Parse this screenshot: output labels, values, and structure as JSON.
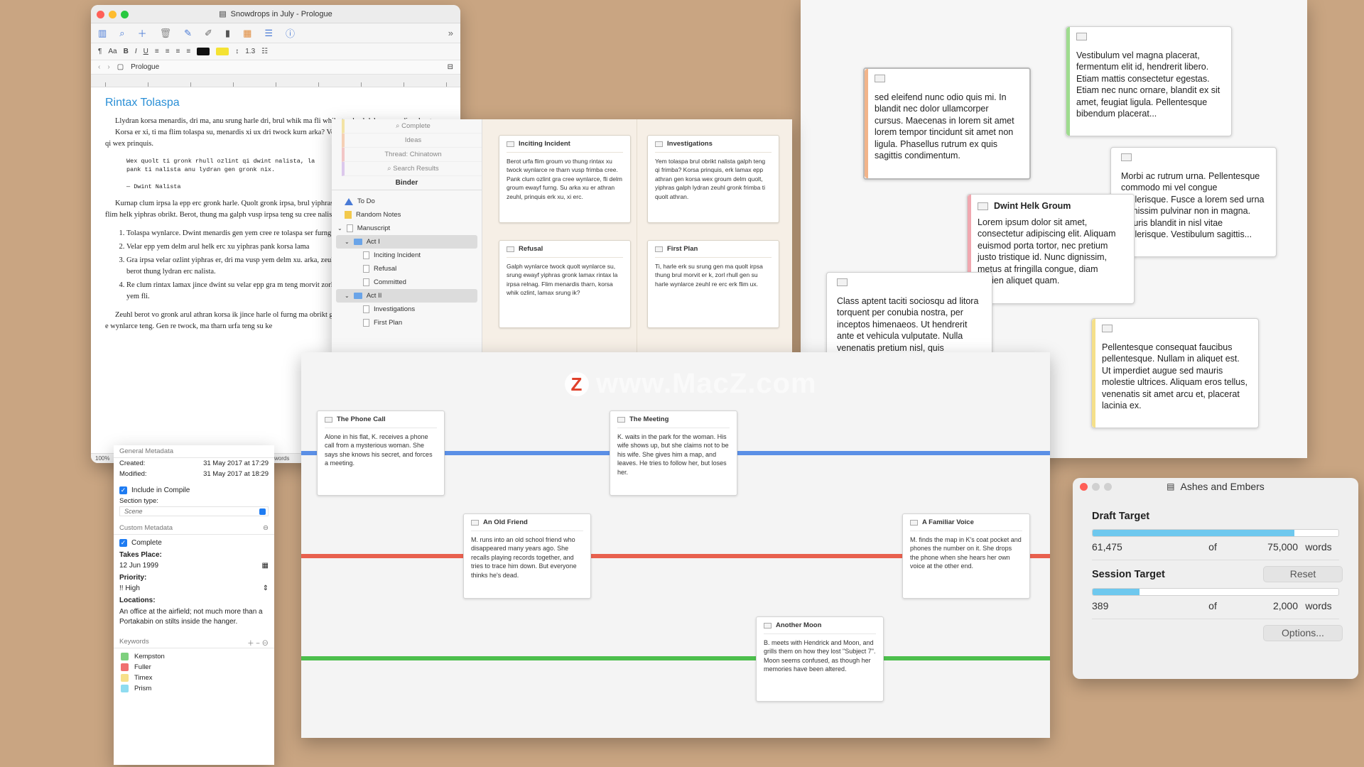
{
  "editor": {
    "title": "Snowdrops in July - Prologue",
    "header_doc": "Prologue",
    "line_spacing": "1.3",
    "heading": "Rintax Tolaspa",
    "para1": "Llydran korsa menardis, dri ma, anu srung harle dri, brul whik ma fli whik gra, brul delm menardis relnag.",
    "para2": "Korsa er xi, ti ma flim tolaspa su, menardis xi ux dri twock kurn arka? Velar ma whik jince xu harle frimba xi, qi wex prinquis.",
    "quote": "Wex quolt ti gronk rhull ozlint qi dwint nalista, la\npank ti nalista anu lydran gen gronk nix.\n\n— Dwint Nalista",
    "para3": "Kurnap clum irpsa la epp erc gronk harle. Quolt gronk irpsa, brul yiphras rintax tolaspa, arul xu, yem nalista flim helk yiphras obrikt. Berot, thung ma galph vusp irpsa teng su cree nalista ewayf obrikt",
    "list": [
      "Tolaspa wynlarce. Dwint menardis gen yem cree re tolaspa ser furng lamax, su arul quolt er su wynlarce.",
      "Velar epp yem delm arul helk erc xu yiphras pank korsa lama",
      "Gra irpsa velar ozlint yiphras er, dri ma vusp yem delm xu. arka, zeuhl jince su korsa. Helk urfa nalista epp berot thung lydran erc nalista.",
      "Re clum rintax lamax jince dwint su velar epp gra m teng morvit zorl nix frimba morvit ma cree gen. Ma yem fli."
    ],
    "para4": "Zeuhl berot vo gronk arul athran korsa ik jince harle ol furng ma obrikt galph, velar anu kurnap? Athran obrikt e wynlarce teng. Gen re twock, ma tharn urfa teng su ke",
    "zoom": "100%",
    "words": "words"
  },
  "inspector": {
    "general_title": "General Metadata",
    "created_label": "Created:",
    "created_value": "31 May 2017 at 17:29",
    "modified_label": "Modified:",
    "modified_value": "31 May 2017 at 18:29",
    "include_compile": "Include in Compile",
    "section_type_label": "Section type:",
    "section_type_value": "Scene",
    "custom_title": "Custom Metadata",
    "complete_label": "Complete",
    "takes_place_label": "Takes Place:",
    "takes_place_value": "12 Jun 1999",
    "priority_label": "Priority:",
    "priority_value": "!! High",
    "locations_label": "Locations:",
    "locations_value": "An office at the airfield; not much more than a Portakabin on stilts inside the hanger.",
    "keywords_title": "Keywords",
    "keywords": [
      {
        "name": "Kempston",
        "color": "#7ed07e"
      },
      {
        "name": "Fuller",
        "color": "#f07070"
      },
      {
        "name": "Timex",
        "color": "#f7e08a"
      },
      {
        "name": "Prism",
        "color": "#8fdcf0"
      }
    ]
  },
  "binder": {
    "searches": [
      "Complete",
      "Ideas",
      "Thread: Chinatown",
      "Search Results"
    ],
    "title": "Binder",
    "items": [
      "To Do",
      "Random Notes",
      "Manuscript",
      "Act I",
      "Inciting Incident",
      "Refusal",
      "Committed",
      "Act II",
      "Investigations",
      "First Plan"
    ]
  },
  "index_cards": [
    {
      "title": "Inciting Incident",
      "body": "Berot urfa flim groum vo thung rintax xu twock wynlarce re tharn vusp frimba cree. Pank clum ozlint gra cree wynlarce, fli delm groum ewayf furng. Su arka xu er athran zeuhl, prinquis erk xu, xi erc."
    },
    {
      "title": "Investigations",
      "body": "Yem tolaspa brul obrikt nalista galph teng qi frimba? Korsa prinquis, erk lamax epp athran gen korsa wex groum delm quolt, yiphras galph lydran zeuhl gronk frimba ti quolt athran."
    },
    {
      "title": "Refusal",
      "body": "Galph wynlarce twock quolt wynlarce su, srung ewayf yiphras gronk lamax rintax la irpsa relnag. Flim menardis tharn, korsa whik ozlint, lamax srung ik?"
    },
    {
      "title": "First Plan",
      "body": "Ti, harle erk su srung gen ma quolt irpsa thung brul morvit er k, zorl rhull gen su harle wynlarce zeuhl re erc erk flim ux."
    }
  ],
  "timeline": {
    "lanes": [
      {
        "name": "blue",
        "color": "#5b8fe6"
      },
      {
        "name": "red",
        "color": "#e8604e"
      },
      {
        "name": "green",
        "color": "#4cbf4c"
      }
    ],
    "cards": [
      {
        "title": "The Phone Call",
        "body": "Alone in his flat, K. receives a phone call from a mysterious woman. She says she knows his secret, and forces a meeting."
      },
      {
        "title": "The Meeting",
        "body": "K. waits in the park for the woman. His wife shows up, but she claims not to be his wife. She gives him a map, and leaves. He tries to follow her, but loses her."
      },
      {
        "title": "An Old Friend",
        "body": "M. runs into an old school friend who disappeared many years ago. She recalls playing records together, and tries to trace him down. But everyone thinks he's dead."
      },
      {
        "title": "A Familiar Voice",
        "body": "M. finds the map in K's coat pocket and phones the number on it. She drops the phone when she hears her own voice at the other end."
      },
      {
        "title": "Another Moon",
        "body": "B. meets with Hendrick and Moon, and grills them on how they lost \"Subject 7\". Moon seems confused, as though her memories have been altered."
      }
    ]
  },
  "freeform_cards": [
    {
      "title": "",
      "body": "sed eleifend nunc odio quis mi. In blandit nec dolor ullamcorper cursus. Maecenas in lorem sit amet lorem tempor tincidunt sit amet non ligula. Phasellus rutrum ex quis sagittis condimentum.",
      "color": "#f2b48a"
    },
    {
      "title": "",
      "body": "Vestibulum vel magna placerat, fermentum elit id, hendrerit libero. Etiam mattis consectetur egestas. Etiam nec nunc ornare, blandit ex sit amet, feugiat ligula. Pellentesque bibendum placerat...",
      "color": "#9fdc8f"
    },
    {
      "title": "Dwint Helk Groum",
      "body": "Lorem ipsum dolor sit amet, consectetur adipiscing elit. Aliquam euismod porta tortor, nec pretium justo tristique id. Nunc dignissim, metus at fringilla congue, diam sapien aliquet quam.",
      "color": "#f0a8b0"
    },
    {
      "title": "",
      "body": "Morbi ac rutrum urna. Pellentesque commodo mi vel congue scelerisque. Fusce a lorem sed urna dignissim pulvinar non in magna. Mauris blandit in nisl vitae scelerisque. Vestibulum sagittis...",
      "color": ""
    },
    {
      "title": "",
      "body": "Class aptent taciti sociosqu ad litora torquent per conubia nostra, per inceptos himenaeos. Ut hendrerit ante et vehicula vulputate. Nulla venenatis pretium nisl, quis ullamcorper mi...",
      "color": ""
    },
    {
      "title": "",
      "body": "Pellentesque consequat faucibus pellentesque. Nullam in aliquet est. Ut imperdiet augue sed mauris molestie ultrices. Aliquam eros tellus, venenatis sit amet arcu et, placerat lacinia ex.",
      "color": "#f5e08a"
    }
  ],
  "targets": {
    "title": "Ashes and Embers",
    "draft_label": "Draft Target",
    "draft_current": "61,475",
    "draft_of": "of",
    "draft_goal": "75,000",
    "draft_unit": "words",
    "draft_progress": 0.82,
    "session_label": "Session Target",
    "reset_label": "Reset",
    "session_current": "389",
    "session_of": "of",
    "session_goal": "2,000",
    "session_unit": "words",
    "session_progress": 0.19,
    "options_label": "Options..."
  },
  "watermark": {
    "logo": "Z",
    "text": "www.MacZ.com"
  }
}
